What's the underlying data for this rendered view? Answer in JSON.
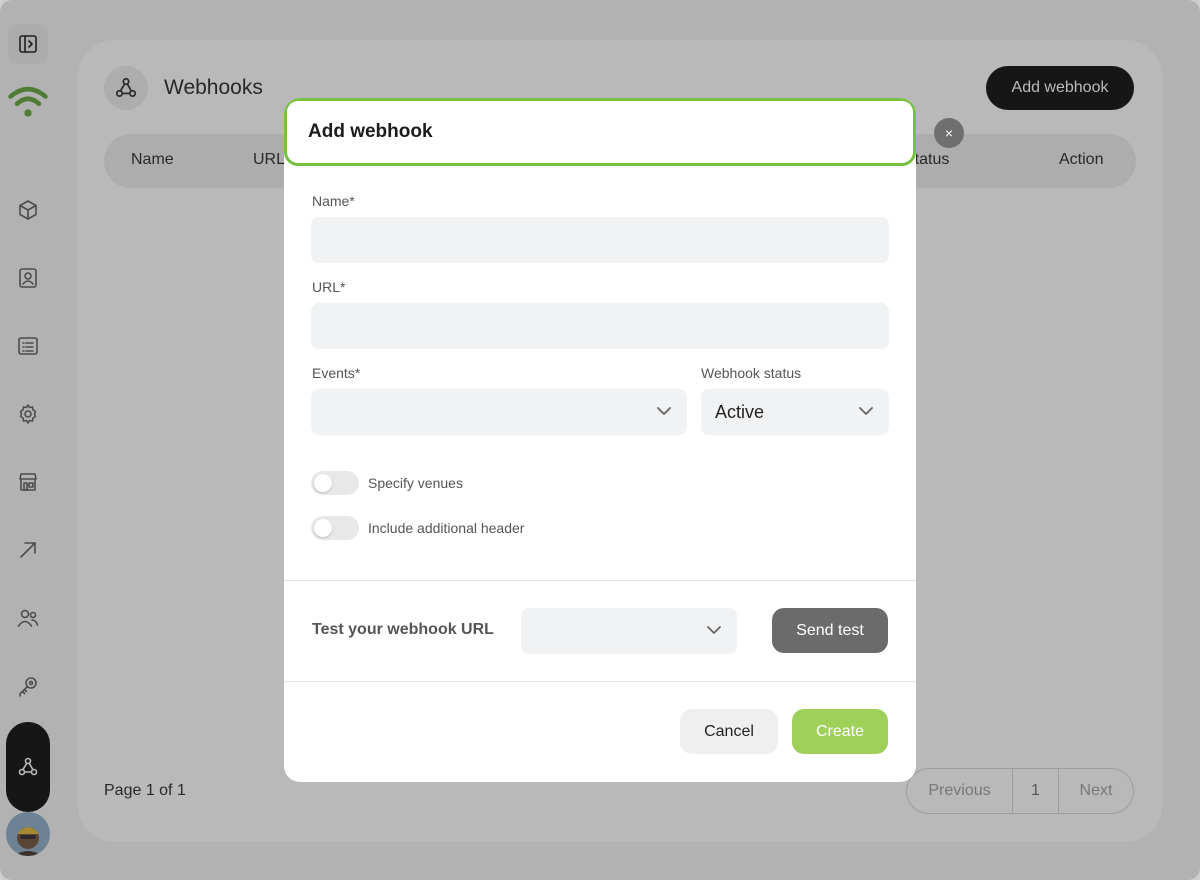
{
  "page": {
    "title": "Webhooks",
    "add_button": "Add webhook",
    "table_headers": [
      "Name",
      "URL",
      "Status",
      "Action"
    ],
    "page_info": "Page 1 of 1",
    "pager": {
      "previous": "Previous",
      "current": "1",
      "next": "Next"
    }
  },
  "modal": {
    "title": "Add webhook",
    "close_label": "×",
    "name_label": "Name*",
    "name_value": "",
    "url_label": "URL*",
    "url_value": "",
    "events_label": "Events*",
    "events_value": "",
    "status_label": "Webhook status",
    "status_value": "Active",
    "toggle_venues": "Specify venues",
    "toggle_header": "Include additional header",
    "test_label": "Test your webhook URL",
    "test_value": "",
    "send_test": "Send test",
    "cancel": "Cancel",
    "create": "Create"
  },
  "colors": {
    "accent_green": "#76c043",
    "create_green": "#9ed05a",
    "logo_green": "#5a9e2f"
  },
  "icons": [
    "sidebar-toggle-icon",
    "wifi-logo-icon",
    "cube-icon",
    "contact-card-icon",
    "list-icon",
    "gear-icon",
    "store-icon",
    "arrow-up-right-icon",
    "users-icon",
    "key-icon",
    "webhook-icon"
  ]
}
